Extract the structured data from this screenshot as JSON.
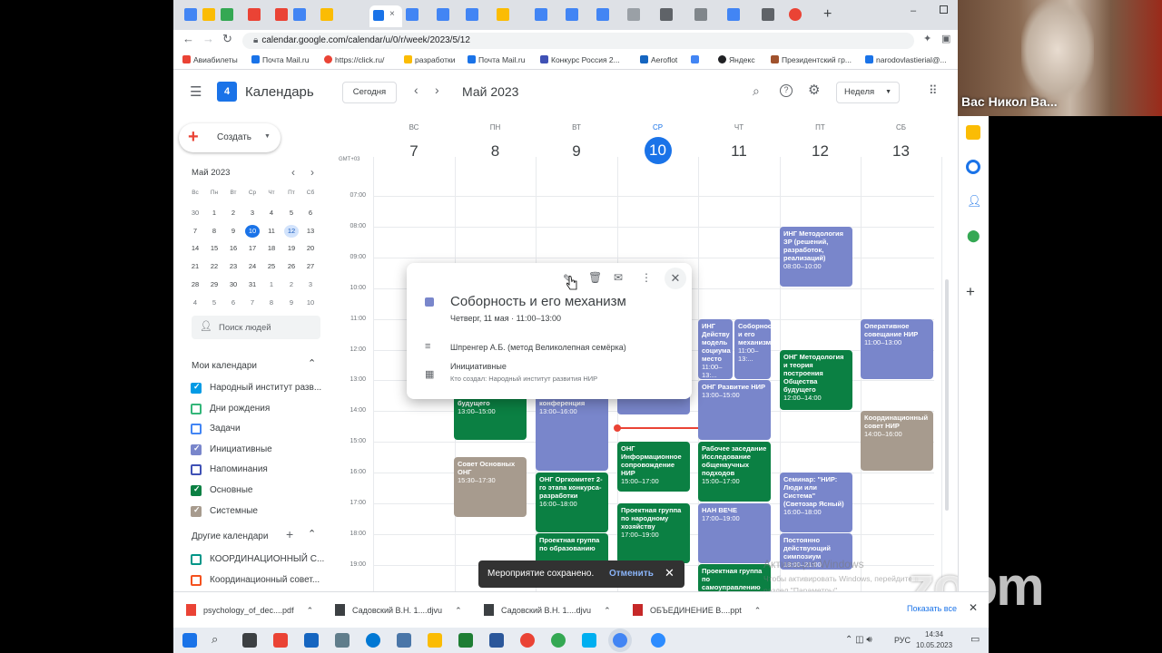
{
  "browser": {
    "url": "calendar.google.com/calendar/u/0/r/week/2023/5/12",
    "bookmarks": [
      "Авиабилеты",
      "Почта Mail.ru",
      "https://click.ru/",
      "разработки",
      "Почта Mail.ru",
      "Конкурс Россия 2...",
      "Aeroflot",
      "Яндекс",
      "Президентский гр...",
      "narodovlastierial@..."
    ]
  },
  "header": {
    "app_name": "Календарь",
    "today_button": "Сегодня",
    "month_label": "Май 2023",
    "view_selector": "Неделя"
  },
  "sidebar": {
    "create_button": "Создать",
    "mini_month": "Май 2023",
    "weekday_heads": [
      "Вс",
      "Пн",
      "Вт",
      "Ср",
      "Чт",
      "Пт",
      "Сб"
    ],
    "weeks": [
      [
        "30",
        "1",
        "2",
        "3",
        "4",
        "5",
        "6"
      ],
      [
        "7",
        "8",
        "9",
        "10",
        "11",
        "12",
        "13"
      ],
      [
        "14",
        "15",
        "16",
        "17",
        "18",
        "19",
        "20"
      ],
      [
        "21",
        "22",
        "23",
        "24",
        "25",
        "26",
        "27"
      ],
      [
        "28",
        "29",
        "30",
        "31",
        "1",
        "2",
        "3"
      ],
      [
        "4",
        "5",
        "6",
        "7",
        "8",
        "9",
        "10"
      ]
    ],
    "search_people": "Поиск людей",
    "my_calendars_title": "Мои календари",
    "my_calendars": [
      {
        "label": "Народный институт разв...",
        "color": "#039be5",
        "checked": true
      },
      {
        "label": "Дни рождения",
        "color": "#33b679",
        "checked": false
      },
      {
        "label": "Задачи",
        "color": "#4285f4",
        "checked": false
      },
      {
        "label": "Инициативные",
        "color": "#7986cb",
        "checked": true
      },
      {
        "label": "Напоминания",
        "color": "#3f51b5",
        "checked": false
      },
      {
        "label": "Основные",
        "color": "#0b8043",
        "checked": true
      },
      {
        "label": "Системные",
        "color": "#a79b8e",
        "checked": true
      }
    ],
    "other_calendars_title": "Другие календари",
    "other_calendars": [
      {
        "label": "КООРДИНАЦИОННЫЙ С...",
        "color": "#009688",
        "checked": false
      },
      {
        "label": "Координационный совет...",
        "color": "#f4511e",
        "checked": false
      }
    ]
  },
  "week": {
    "timezone": "GMT+03",
    "days": [
      {
        "name": "ВС",
        "num": "7"
      },
      {
        "name": "ПН",
        "num": "8"
      },
      {
        "name": "ВТ",
        "num": "9"
      },
      {
        "name": "СР",
        "num": "10",
        "today": true
      },
      {
        "name": "ЧТ",
        "num": "11"
      },
      {
        "name": "ПТ",
        "num": "12"
      },
      {
        "name": "СБ",
        "num": "13"
      }
    ],
    "hours": [
      "07:00",
      "08:00",
      "09:00",
      "10:00",
      "11:00",
      "12:00",
      "13:00",
      "14:00",
      "15:00",
      "16:00",
      "17:00",
      "18:00",
      "19:00"
    ]
  },
  "events": [
    {
      "title": "ИНГ Методология ЗР (решений, разработок, реализаций)",
      "time": "08:00–10:00",
      "color": "#7986cb"
    },
    {
      "title": "ИНГ Действу модель социума место",
      "time": "11:00–13:...",
      "color": "#7986cb"
    },
    {
      "title": "Соборность и его механизм",
      "time": "11:00–13:...",
      "color": "#7986cb"
    },
    {
      "title": "Оперативное совещание НИР",
      "time": "11:00–13:00",
      "color": "#7986cb"
    },
    {
      "title": "ОНГ Методология и теория построения Общества будущего",
      "time": "12:00–14:00",
      "color": "#0b8043"
    },
    {
      "title": "ОНГ Развитие НИР",
      "time": "13:00–15:00",
      "color": "#7986cb"
    },
    {
      "title": "построения Общества будущего",
      "time": "13:00–15:00",
      "color": "#0b8043"
    },
    {
      "title": "творческая исследовательская конференция",
      "time": "13:00–16:00",
      "color": "#7986cb"
    },
    {
      "title": "",
      "time": "13:00–15:00",
      "color": "#7986cb"
    },
    {
      "title": "Координационный совет НИР",
      "time": "14:00–16:00",
      "color": "#a79b8e"
    },
    {
      "title": "ОНГ Информационное сопровождение НИР",
      "time": "15:00–17:00",
      "color": "#0b8043"
    },
    {
      "title": "Рабочее заседание Исследование общенаучных подходов",
      "time": "15:00–17:00",
      "color": "#0b8043"
    },
    {
      "title": "Совет Основных ОНГ",
      "time": "15:30–17:30",
      "color": "#a79b8e"
    },
    {
      "title": "ОНГ Оргкомитет 2-го этапа конкурса-разработки",
      "time": "16:00–18:00",
      "color": "#0b8043"
    },
    {
      "title": "Семинар: \"НИР: Люди или Система\" (Светозар Ясный)",
      "time": "16:00–18:00",
      "color": "#7986cb"
    },
    {
      "title": "Проектная группа по народному хозяйству",
      "time": "17:00–19:00",
      "color": "#0b8043"
    },
    {
      "title": "НАН ВЕЧЕ",
      "time": "17:00–19:00",
      "color": "#7986cb"
    },
    {
      "title": "Проектная группа по образованию",
      "time": "",
      "color": "#0b8043"
    },
    {
      "title": "Постоянно действующий симпозиум",
      "time": "18:00–21:00",
      "color": "#7986cb"
    },
    {
      "title": "Проектная группа по самоуправлению",
      "time": "",
      "color": "#0b8043"
    }
  ],
  "popup": {
    "title": "Соборность и его механизм",
    "when": "Четверг, 11 мая  ·  11:00–13:00",
    "description": "Шпренгер А.Б. (метод Великолепная семёрка)",
    "calendar": "Инициативные",
    "creator": "Кто создал: Народный институт развития НИР",
    "color": "#7986cb"
  },
  "toast": {
    "message": "Мероприятие сохранено.",
    "action": "Отменить"
  },
  "downloads": {
    "items": [
      "psychology_of_dec....pdf",
      "Садовский В.Н. 1....djvu",
      "Садовский В.Н. 1....djvu",
      "ОБЪЕДИНЕНИЕ В....ppt"
    ],
    "show_all": "Показать все"
  },
  "watermark": {
    "line1": "Активация Windows",
    "line2": "Чтобы активировать Windows, перейдите в",
    "line3": "раздел \"Параметры\".",
    "zoom": "zoom"
  },
  "taskbar": {
    "lang": "РУС",
    "time": "14:34",
    "date": "10.05.2023"
  },
  "video": {
    "participant": "Вас Никол Ва..."
  }
}
